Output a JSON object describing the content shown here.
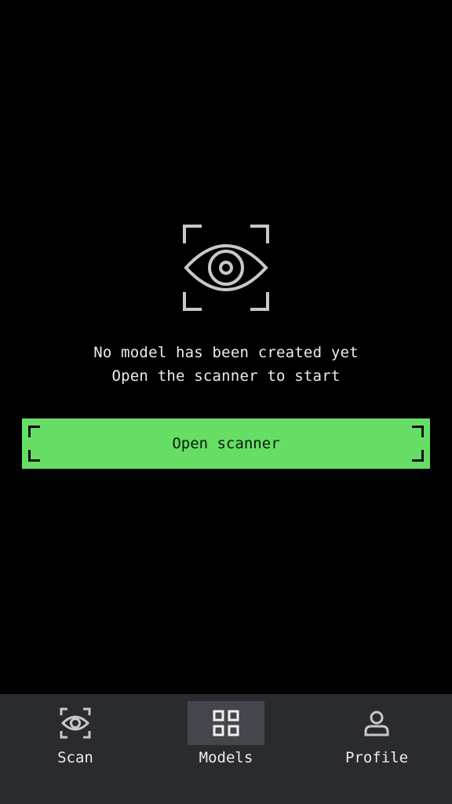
{
  "main": {
    "hero_icon": "scan-eye-icon",
    "empty_line_1": "No model has been created yet",
    "empty_line_2": "Open the scanner to start",
    "open_scanner_label": "Open scanner"
  },
  "nav": {
    "items": [
      {
        "label": "Scan",
        "icon": "scan-eye-icon",
        "active": false
      },
      {
        "label": "Models",
        "icon": "grid-icon",
        "active": true
      },
      {
        "label": "Profile",
        "icon": "user-icon",
        "active": false
      }
    ]
  },
  "colors": {
    "background": "#000000",
    "accent": "#66de66",
    "nav_background": "#2a2b2f",
    "nav_active": "#45464c",
    "icon": "#c8c8c8"
  }
}
